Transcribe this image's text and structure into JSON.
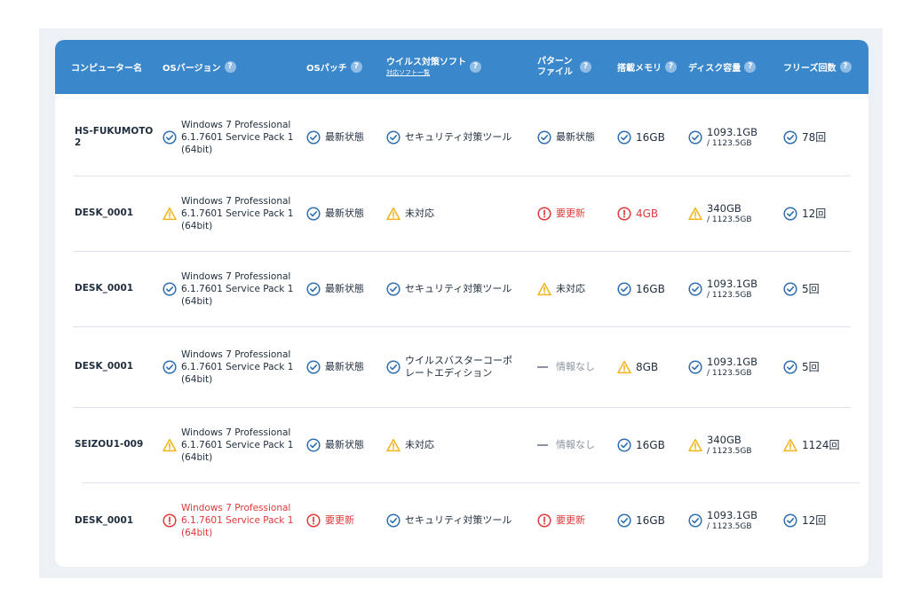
{
  "headers": {
    "computer": "コンピューター名",
    "os": "OSバージョン",
    "patch": "OSパッチ",
    "antivirus": "ウイルス対策ソフト",
    "antivirus_link": "対応ソフト一覧",
    "pattern_line1": "パターン",
    "pattern_line2": "ファイル",
    "memory": "搭載メモリ",
    "disk": "ディスク容量",
    "freeze": "フリーズ回数",
    "help": "?"
  },
  "rows": [
    {
      "name": "HS-FUKUMOTO2",
      "os": {
        "status": "ok",
        "lines": [
          "Windows 7 Professional",
          "6.1.7601 Service Pack 1",
          "(64bit)"
        ]
      },
      "patch": {
        "status": "ok",
        "text": "最新状態"
      },
      "antivirus": {
        "status": "ok",
        "lines": [
          "セキュリティ対策ツール"
        ]
      },
      "pattern": {
        "status": "ok",
        "text": "最新状態"
      },
      "memory": {
        "status": "ok",
        "text": "16GB"
      },
      "disk": {
        "status": "ok",
        "used": "1093.1GB",
        "total": "/ 1123.5GB"
      },
      "freeze": {
        "status": "ok",
        "text": "78回"
      }
    },
    {
      "name": "DESK_0001",
      "os": {
        "status": "warn",
        "lines": [
          "Windows 7 Professional",
          "6.1.7601 Service Pack 1",
          "(64bit)"
        ]
      },
      "patch": {
        "status": "ok",
        "text": "最新状態"
      },
      "antivirus": {
        "status": "warn",
        "lines": [
          "未対応"
        ]
      },
      "pattern": {
        "status": "error",
        "text": "要更新"
      },
      "memory": {
        "status": "error",
        "text": "4GB"
      },
      "disk": {
        "status": "warn",
        "used": "340GB",
        "total": "/ 1123.5GB"
      },
      "freeze": {
        "status": "ok",
        "text": "12回"
      }
    },
    {
      "name": "DESK_0001",
      "os": {
        "status": "ok",
        "lines": [
          "Windows 7 Professional",
          "6.1.7601 Service Pack 1",
          "(64bit)"
        ]
      },
      "patch": {
        "status": "ok",
        "text": "最新状態"
      },
      "antivirus": {
        "status": "ok",
        "lines": [
          "セキュリティ対策ツール"
        ]
      },
      "pattern": {
        "status": "warn",
        "text": "未対応"
      },
      "memory": {
        "status": "ok",
        "text": "16GB"
      },
      "disk": {
        "status": "ok",
        "used": "1093.1GB",
        "total": "/ 1123.5GB"
      },
      "freeze": {
        "status": "ok",
        "text": "5回"
      }
    },
    {
      "name": "DESK_0001",
      "os": {
        "status": "ok",
        "lines": [
          "Windows 7 Professional",
          "6.1.7601 Service Pack 1",
          "(64bit)"
        ]
      },
      "patch": {
        "status": "ok",
        "text": "最新状態"
      },
      "antivirus": {
        "status": "ok",
        "lines": [
          "ウイルスバスターコーポ",
          "レートエディション"
        ]
      },
      "pattern": {
        "status": "none",
        "text": "情報なし"
      },
      "memory": {
        "status": "warn",
        "text": "8GB"
      },
      "disk": {
        "status": "ok",
        "used": "1093.1GB",
        "total": "/ 1123.5GB"
      },
      "freeze": {
        "status": "ok",
        "text": "5回"
      }
    },
    {
      "name": "SEIZOU1-009",
      "os": {
        "status": "warn",
        "lines": [
          "Windows 7 Professional",
          "6.1.7601 Service Pack 1",
          "(64bit)"
        ]
      },
      "patch": {
        "status": "ok",
        "text": "最新状態"
      },
      "antivirus": {
        "status": "warn",
        "lines": [
          "未対応"
        ]
      },
      "pattern": {
        "status": "none",
        "text": "情報なし"
      },
      "memory": {
        "status": "ok",
        "text": "16GB"
      },
      "disk": {
        "status": "warn",
        "used": "340GB",
        "total": "/ 1123.5GB"
      },
      "freeze": {
        "status": "warn",
        "text": "1124回"
      }
    },
    {
      "name": "DESK_0001",
      "os": {
        "status": "error",
        "lines": [
          "Windows 7 Professional",
          "6.1.7601 Service Pack 1",
          "(64bit)"
        ]
      },
      "patch": {
        "status": "error",
        "text": "要更新"
      },
      "antivirus": {
        "status": "ok",
        "lines": [
          "セキュリティ対策ツール"
        ]
      },
      "pattern": {
        "status": "error",
        "text": "要更新"
      },
      "memory": {
        "status": "ok",
        "text": "16GB"
      },
      "disk": {
        "status": "ok",
        "used": "1093.1GB",
        "total": "/ 1123.5GB"
      },
      "freeze": {
        "status": "ok",
        "text": "12回"
      }
    }
  ],
  "colors": {
    "header": "#3a87cc",
    "ok": "#2f6fb0",
    "warn": "#f2b31b",
    "error": "#e03a3a",
    "none": "#8a94a0"
  }
}
